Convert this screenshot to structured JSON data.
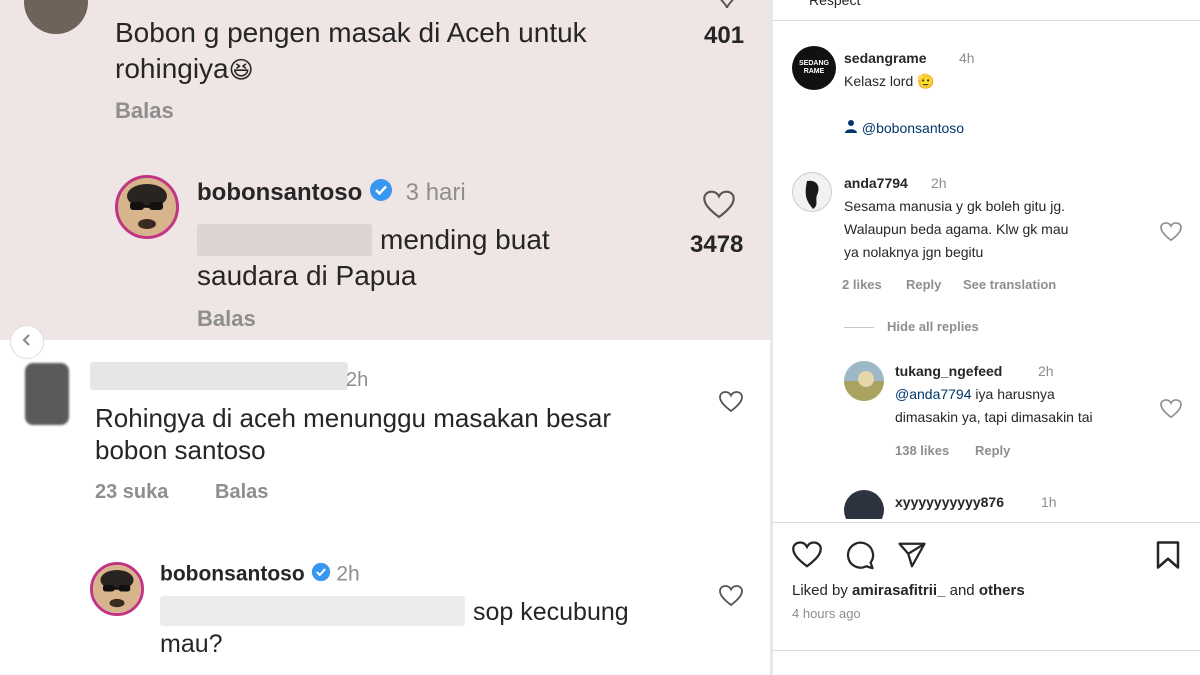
{
  "left_panel": {
    "comment1": {
      "text_line1": "Bobon g pengen masak di Aceh untuk",
      "text_line2": "rohingiya",
      "emoji": "😆",
      "likes": "401",
      "reply_label": "Balas"
    },
    "reply1": {
      "username": "bobonsantoso",
      "time": "3 hari",
      "text_line1": "mending buat",
      "text_line2": "saudara di Papua",
      "likes": "3478",
      "reply_label": "Balas"
    },
    "comment2": {
      "time": "2h",
      "text_line1": "Rohingya di aceh menunggu masakan besar",
      "text_line2": "bobon santoso",
      "likes_label": "23 suka",
      "reply_label": "Balas"
    },
    "reply2": {
      "username": "bobonsantoso",
      "time": "2h",
      "text_line1": "sop kecubung",
      "text_line2": "mau?"
    }
  },
  "right_panel": {
    "cut_top_text": "Respect",
    "post1": {
      "username": "sedangrame",
      "avatar_text_1": "SEDANG",
      "avatar_text_2": "RAME",
      "time": "4h",
      "text": "Kelasz lord",
      "emoji": "🫡",
      "tag": "@bobonsantoso"
    },
    "comment_anda": {
      "username": "anda7794",
      "time": "2h",
      "line1": "Sesama manusia y gk boleh gitu jg.",
      "line2": "Walaupun beda agama. Klw gk mau",
      "line3": "ya nolaknya jgn begitu",
      "likes": "2 likes",
      "reply": "Reply",
      "see_translation": "See translation",
      "hide_replies": "Hide all replies"
    },
    "comment_tukang": {
      "username": "tukang_ngefeed",
      "time": "2h",
      "mention": "@anda7794",
      "line1_rest": " iya harusnya",
      "line2": "dimasakin ya, tapi dimasakin tai",
      "likes": "138 likes",
      "reply": "Reply"
    },
    "comment_xyy": {
      "username": "xyyyyyyyyyy876",
      "time": "1h"
    },
    "footer": {
      "liked_by_prefix": "Liked by",
      "liked_by_user": "amirasafitrii_",
      "liked_by_and": "and",
      "liked_by_others": "others",
      "time_ago": "4 hours ago"
    }
  },
  "colors": {
    "left_top_bg": "#efe5e4",
    "verified_blue": "#3897f0",
    "text_dark": "#262626",
    "text_gray": "#8e8e8e",
    "mention_blue": "#00376b"
  },
  "icons": [
    "heart-icon",
    "comment-icon",
    "share-icon",
    "bookmark-icon",
    "verified-icon",
    "chevron-left-icon",
    "user-tag-icon"
  ]
}
